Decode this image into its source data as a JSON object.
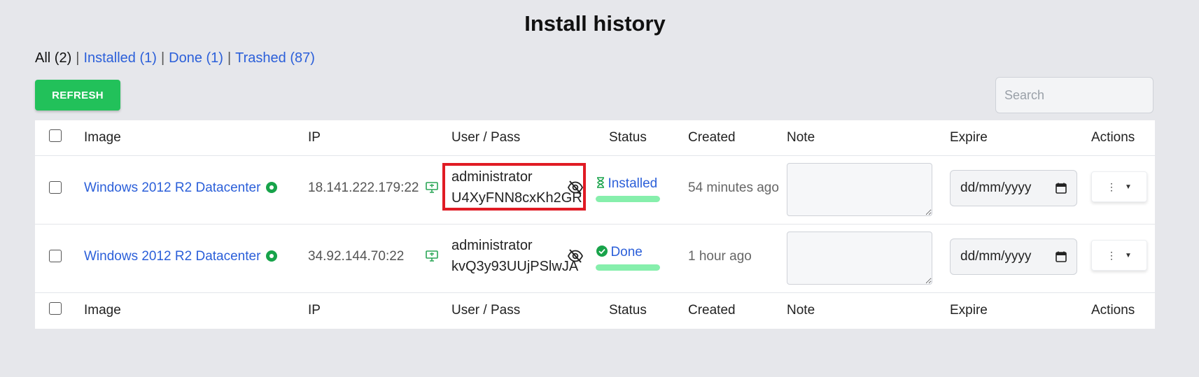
{
  "page": {
    "title": "Install history"
  },
  "filters": [
    {
      "label": "All (2)",
      "active": true
    },
    {
      "label": "Installed (1)",
      "active": false
    },
    {
      "label": "Done (1)",
      "active": false
    },
    {
      "label": "Trashed (87)",
      "active": false
    }
  ],
  "toolbar": {
    "refresh_label": "REFRESH",
    "search_placeholder": "Search"
  },
  "table": {
    "headers": [
      "Image",
      "IP",
      "User / Pass",
      "Status",
      "Created",
      "Note",
      "Expire",
      "Actions"
    ],
    "rows": [
      {
        "image": "Windows 2012 R2 Datacenter",
        "ip": "18.141.222.179:22",
        "user": "administrator",
        "pass": "U4XyFNN8cxKh2GR",
        "status": "Installed",
        "status_icon": "hourglass-icon",
        "status_progress": 1.0,
        "created": "54 minutes ago",
        "note": "",
        "expire": "dd/mm/yyyy",
        "highlighted": true
      },
      {
        "image": "Windows 2012 R2 Datacenter",
        "ip": "34.92.144.70:22",
        "user": "administrator",
        "pass": "kvQ3y93UUjPSlwJA",
        "status": "Done",
        "status_icon": "check-circle-icon",
        "status_progress": 1.0,
        "created": "1 hour ago",
        "note": "",
        "expire": "dd/mm/yyyy",
        "highlighted": false
      }
    ]
  },
  "colors": {
    "accent_link": "#2b5fd9",
    "refresh_button": "#22c15a",
    "online": "#17a34a",
    "status_bar": "#86efac",
    "highlight": "#e01b24"
  }
}
